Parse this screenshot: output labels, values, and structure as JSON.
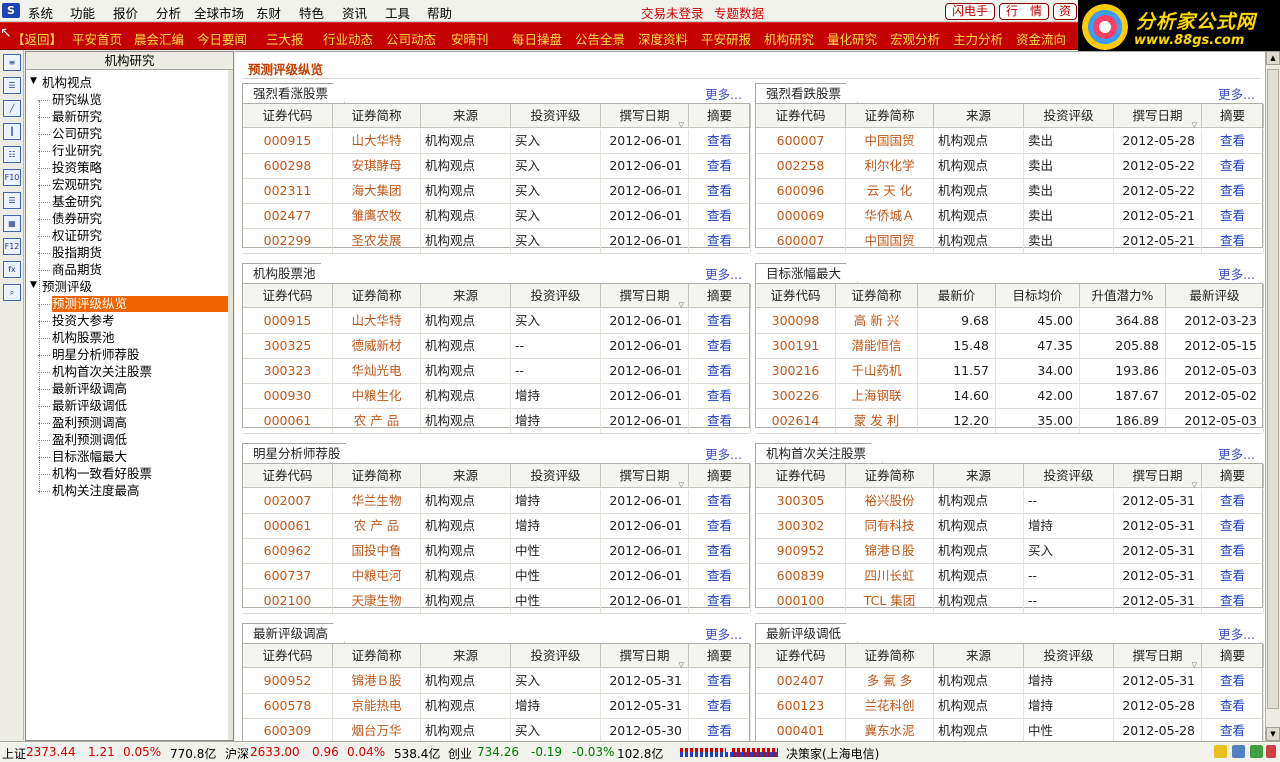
{
  "menubar": {
    "items": [
      "系统",
      "功能",
      "报价",
      "分析",
      "全球市场",
      "东财",
      "特色",
      "资讯",
      "工具",
      "帮助"
    ],
    "login_status": "交易未登录",
    "special_data": "专题数据",
    "buttons": [
      "闪电手",
      "行　情",
      "资"
    ]
  },
  "site_logo": {
    "title": "分析家公式网",
    "url_text": "www.88gs.com"
  },
  "navbar": {
    "back": "【返回】",
    "items": [
      "平安首页",
      "晨会汇编",
      "今日要闻",
      "三大报",
      "行业动态",
      "公司动态",
      "安晴刊",
      "每日操盘",
      "公告全景",
      "深度资料",
      "平安研报",
      "机构研究",
      "量化研究",
      "宏观分析",
      "主力分析",
      "资金流向"
    ]
  },
  "toolbar_icons": [
    "news-icon",
    "list-icon",
    "line-chart-icon",
    "candlestick-icon",
    "table-icon",
    "f10-icon",
    "tick-icon",
    "calendar-icon",
    "f12-icon",
    "formula-icon",
    "search-icon"
  ],
  "left_panel": {
    "title": "机构研究",
    "groups": [
      {
        "label": "机构视点",
        "items": [
          "研究纵览",
          "最新研究",
          "公司研究",
          "行业研究",
          "投资策略",
          "宏观研究",
          "基金研究",
          "债券研究",
          "权证研究",
          "股指期货",
          "商品期货"
        ]
      },
      {
        "label": "预测评级",
        "items": [
          "预测评级纵览",
          "投资大参考",
          "机构股票池",
          "明星分析师荐股",
          "机构首次关注股票",
          "最新评级调高",
          "最新评级调低",
          "盈利预测调高",
          "盈利预测调低",
          "目标涨幅最大",
          "机构一致看好股票",
          "机构关注度最高"
        ]
      }
    ],
    "selected": "预测评级纵览"
  },
  "main": {
    "title": "预测评级纵览",
    "more_label": "更多...",
    "std_headers": [
      "证券代码",
      "证券简称",
      "来源",
      "投资评级",
      "撰写日期",
      "摘要"
    ],
    "target_headers": [
      "证券代码",
      "证券简称",
      "最新价",
      "目标均价",
      "升值潜力%",
      "最新评级"
    ],
    "view_label": "查看",
    "sections": [
      {
        "title": "强烈看涨股票",
        "rows": [
          [
            "000915",
            "山大华特",
            "机构观点",
            "买入",
            "2012-06-01"
          ],
          [
            "600298",
            "安琪酵母",
            "机构观点",
            "买入",
            "2012-06-01"
          ],
          [
            "002311",
            "海大集团",
            "机构观点",
            "买入",
            "2012-06-01"
          ],
          [
            "002477",
            "雏鹰农牧",
            "机构观点",
            "买入",
            "2012-06-01"
          ],
          [
            "002299",
            "圣农发展",
            "机构观点",
            "买入",
            "2012-06-01"
          ]
        ]
      },
      {
        "title": "强烈看跌股票",
        "rows": [
          [
            "600007",
            "中国国贸",
            "机构观点",
            "卖出",
            "2012-05-28"
          ],
          [
            "002258",
            "利尔化学",
            "机构观点",
            "卖出",
            "2012-05-22"
          ],
          [
            "600096",
            "云 天 化",
            "机构观点",
            "卖出",
            "2012-05-22"
          ],
          [
            "000069",
            "华侨城Ａ",
            "机构观点",
            "卖出",
            "2012-05-21"
          ],
          [
            "600007",
            "中国国贸",
            "机构观点",
            "卖出",
            "2012-05-21"
          ]
        ]
      },
      {
        "title": "机构股票池",
        "rows": [
          [
            "000915",
            "山大华特",
            "机构观点",
            "买入",
            "2012-06-01"
          ],
          [
            "300325",
            "德威新材",
            "机构观点",
            "--",
            "2012-06-01"
          ],
          [
            "300323",
            "华灿光电",
            "机构观点",
            "--",
            "2012-06-01"
          ],
          [
            "000930",
            "中粮生化",
            "机构观点",
            "增持",
            "2012-06-01"
          ],
          [
            "000061",
            "农 产 品",
            "机构观点",
            "增持",
            "2012-06-01"
          ]
        ]
      },
      {
        "title": "目标涨幅最大",
        "rows": [
          [
            "300098",
            "高 新 兴",
            "9.68",
            "45.00",
            "364.88",
            "2012-03-23"
          ],
          [
            "300191",
            "潜能恒信",
            "15.48",
            "47.35",
            "205.88",
            "2012-05-15"
          ],
          [
            "300216",
            "千山药机",
            "11.57",
            "34.00",
            "193.86",
            "2012-05-03"
          ],
          [
            "300226",
            "上海钢联",
            "14.60",
            "42.00",
            "187.67",
            "2012-05-02"
          ],
          [
            "002614",
            "蒙 发 利",
            "12.20",
            "35.00",
            "186.89",
            "2012-05-03"
          ]
        ]
      },
      {
        "title": "明星分析师荐股",
        "rows": [
          [
            "002007",
            "华兰生物",
            "机构观点",
            "增持",
            "2012-06-01"
          ],
          [
            "000061",
            "农 产 品",
            "机构观点",
            "增持",
            "2012-06-01"
          ],
          [
            "600962",
            "国投中鲁",
            "机构观点",
            "中性",
            "2012-06-01"
          ],
          [
            "600737",
            "中粮屯河",
            "机构观点",
            "中性",
            "2012-06-01"
          ],
          [
            "002100",
            "天康生物",
            "机构观点",
            "中性",
            "2012-06-01"
          ]
        ]
      },
      {
        "title": "机构首次关注股票",
        "rows": [
          [
            "300305",
            "裕兴股份",
            "机构观点",
            "--",
            "2012-05-31"
          ],
          [
            "300302",
            "同有科技",
            "机构观点",
            "增持",
            "2012-05-31"
          ],
          [
            "900952",
            "锦港Ｂ股",
            "机构观点",
            "买入",
            "2012-05-31"
          ],
          [
            "600839",
            "四川长虹",
            "机构观点",
            "--",
            "2012-05-31"
          ],
          [
            "000100",
            "TCL 集团",
            "机构观点",
            "--",
            "2012-05-31"
          ]
        ]
      },
      {
        "title": "最新评级调高",
        "rows": [
          [
            "900952",
            "锦港Ｂ股",
            "机构观点",
            "买入",
            "2012-05-31"
          ],
          [
            "600578",
            "京能热电",
            "机构观点",
            "增持",
            "2012-05-31"
          ],
          [
            "600309",
            "烟台万华",
            "机构观点",
            "买入",
            "2012-05-30"
          ]
        ]
      },
      {
        "title": "最新评级调低",
        "rows": [
          [
            "002407",
            "多 氟 多",
            "机构观点",
            "增持",
            "2012-05-31"
          ],
          [
            "600123",
            "兰花科创",
            "机构观点",
            "增持",
            "2012-05-28"
          ],
          [
            "000401",
            "冀东水泥",
            "机构观点",
            "中性",
            "2012-05-28"
          ]
        ]
      }
    ]
  },
  "statusbar": {
    "sh_label": "上证",
    "sh_index": "2373.44",
    "sh_change": "1.21",
    "sh_pct": "0.05%",
    "sh_vol": "770.8亿",
    "sz_label": "沪深",
    "sz_index": "2633.00",
    "sz_change": "0.96",
    "sz_pct": "0.04%",
    "sz_vol": "538.4亿",
    "cy_label": "创业",
    "cy_index": "734.26",
    "cy_change": "-0.19",
    "cy_pct": "-0.03%",
    "cy_vol": "102.8亿",
    "app_name": "决策家(上海电信)"
  },
  "colors": {
    "nav_bg": "#c40000",
    "nav_text": "#ffe040",
    "code_text": "#c05818",
    "link": "#2040c0",
    "selection": "#f06400"
  }
}
